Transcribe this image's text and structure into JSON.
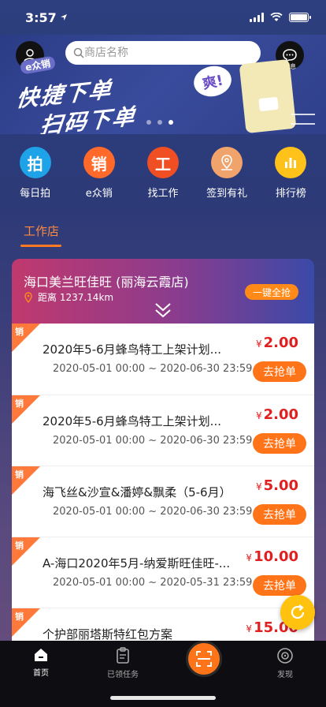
{
  "status_bar": {
    "time": "3:57"
  },
  "header": {
    "avatar_label": "我的",
    "search_placeholder": "商店名称",
    "message_label": "消息",
    "banner": {
      "tag": "e众销",
      "line1": "快捷下单",
      "line2": "扫码下单",
      "badge": "爽!"
    }
  },
  "quick_nav": [
    {
      "label": "每日拍",
      "glyph": "拍",
      "color": "#1ea2e8"
    },
    {
      "label": "e众销",
      "glyph": "销",
      "color": "#ff6a2a"
    },
    {
      "label": "找工作",
      "glyph": "工",
      "color": "#f04e23"
    },
    {
      "label": "签到有礼",
      "glyph": "⌖",
      "color": "#f0a36a"
    },
    {
      "label": "排行榜",
      "glyph": "▮",
      "color": "#ffc21a"
    }
  ],
  "section": {
    "tab_label": "工作店"
  },
  "store": {
    "name": "海口美兰旺佳旺 (丽海云霞店)",
    "distance": "距离 1237.14km",
    "grab_all_label": "一键全抢"
  },
  "items": [
    {
      "tag": "销",
      "title": "2020年5-6月蜂鸟特工上架计划...",
      "date": "2020-05-01 00:00 ~ 2020-06-30 23:59",
      "currency": "¥",
      "price": "2.00",
      "button": "去抢单"
    },
    {
      "tag": "销",
      "title": "2020年5-6月蜂鸟特工上架计划...",
      "date": "2020-05-01 00:00 ~ 2020-06-30 23:59",
      "currency": "¥",
      "price": "2.00",
      "button": "去抢单"
    },
    {
      "tag": "销",
      "title": "海飞丝&沙宣&潘婷&飘柔（5-6月）",
      "date": "2020-05-01 00:00 ~ 2020-06-30 23:59",
      "currency": "¥",
      "price": "5.00",
      "button": "去抢单"
    },
    {
      "tag": "销",
      "title": "A-海口2020年5月-纳爱斯旺佳旺-...",
      "date": "2020-05-01 00:00 ~ 2020-05-31 23:59",
      "currency": "¥",
      "price": "10.00",
      "button": "去抢单"
    },
    {
      "tag": "销",
      "title": "个护部丽塔斯特红包方案",
      "date": "",
      "currency": "¥",
      "price": "15.00",
      "button": ""
    }
  ],
  "tabbar": {
    "home": "首页",
    "tasks": "已领任务",
    "discover": "发现"
  }
}
